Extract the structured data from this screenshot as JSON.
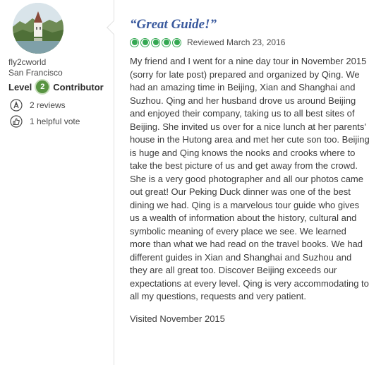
{
  "reviewer": {
    "username": "fly2cworld",
    "location": "San Francisco",
    "level_label": "Level",
    "level_number": "2",
    "level_title": "Contributor",
    "reviews_count": "2 reviews",
    "helpful_votes": "1 helpful vote",
    "avatar_icon": "landscape-photo-icon",
    "reviews_icon": "pen-icon",
    "helpful_icon": "thumbs-up-icon"
  },
  "review": {
    "title": "“Great Guide!”",
    "rating": 5,
    "rating_max": 5,
    "rating_color": "#34a852",
    "reviewed_date": "Reviewed March 23, 2016",
    "body": "My friend and I went for a nine day tour in November 2015 (sorry for late post) prepared and organized by Qing. We had an amazing time in Beijing, Xian and Shanghai and Suzhou. Qing and her husband drove us around Beijing and enjoyed their company, taking us to all best sites of Beijing. She invited us over for a nice lunch at her parents' house in the Hutong area and met her cute son too. Beijing is huge and Qing knows the nooks and crooks where to take the best picture of us and get away from the crowd. She is a very good photographer and all our photos came out great! Our Peking Duck dinner was one of the best dining we had. Qing is a marvelous tour guide who gives us a wealth of information about the history, cultural and symbolic meaning of every place we see. We learned more than what we had read on the travel books. We had different guides in Xian and Shanghai and Suzhou and they are all great too. Discover Beijing exceeds our expectations at every level. Qing is very accommodating to all my questions, requests and very patient.",
    "visited": "Visited November 2015"
  },
  "colors": {
    "title_blue": "#3a5a9e",
    "level_green": "#589442",
    "text": "#3b3b3b"
  }
}
